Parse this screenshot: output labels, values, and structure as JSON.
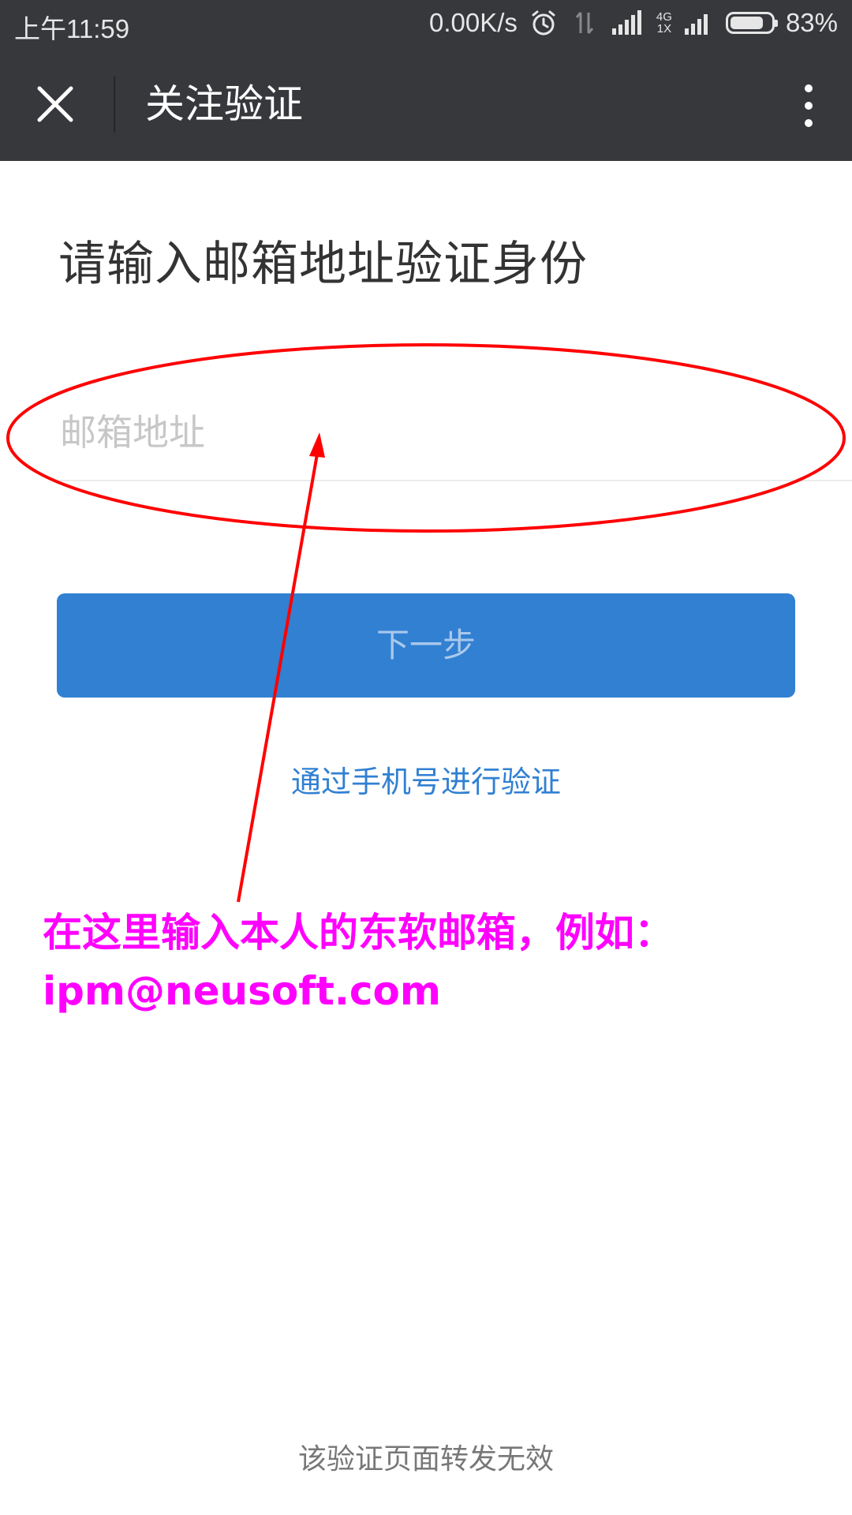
{
  "status_bar": {
    "time": "上午11:59",
    "net_speed": "0.00K/s",
    "network_top": "4G",
    "network_bottom": "1X",
    "battery": "83%",
    "battery_level": 0.83,
    "icons": [
      "alarm-icon",
      "data-transfer-icon",
      "signal-icon",
      "signal-icon",
      "battery-icon"
    ]
  },
  "title_bar": {
    "title": "关注验证",
    "close_icon": "close-icon",
    "more_icon": "more-vertical-icon",
    "background": "#37383c"
  },
  "form": {
    "heading": "请输入邮箱地址验证身份",
    "email_placeholder": "邮箱地址",
    "email_value": "",
    "next_label": "下一步",
    "phone_link": "通过手机号进行验证",
    "accent": "#3180d2"
  },
  "annotation": {
    "line1": "在这里输入本人的东软邮箱，例如：",
    "line2": "ipm@neusoft.com",
    "color": "#ff00ff",
    "mark_color": "#ff0000"
  },
  "footer": {
    "text": "该验证页面转发无效"
  }
}
